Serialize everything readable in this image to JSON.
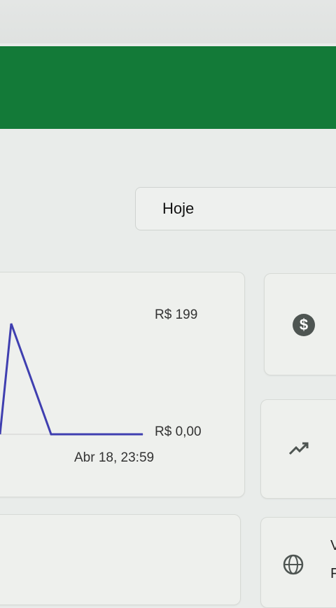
{
  "header": {
    "color": "#137a38"
  },
  "date_filter": {
    "selected": "Hoje"
  },
  "chart_data": {
    "type": "line",
    "series": [
      {
        "values": [
          0,
          199,
          0,
          0
        ]
      }
    ],
    "y_labels": [
      "R$ 199",
      "R$ 0,00"
    ],
    "x_label": "Abr 18, 23:59",
    "line_color": "#3f3fb0"
  },
  "side_cards": [
    {
      "icon": "dollar-icon"
    },
    {
      "icon": "trending-up-icon"
    },
    {
      "icon": "globe-icon",
      "text_1": "V",
      "text_2": "F"
    }
  ]
}
